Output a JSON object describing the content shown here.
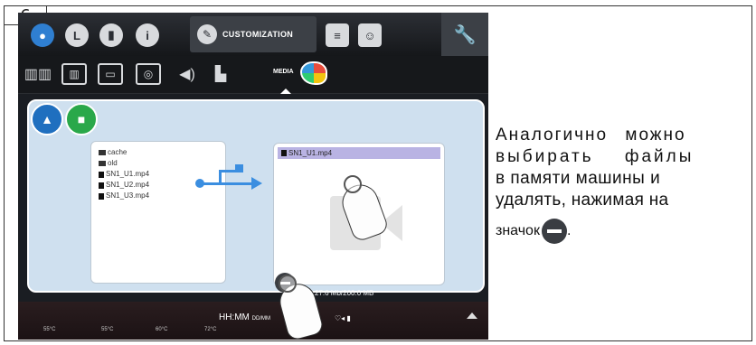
{
  "step": {
    "number": "6"
  },
  "topbar": {
    "customization_label": "CUSTOMIZATION"
  },
  "subbar": {
    "media_label": "MEDIA"
  },
  "media_panel": {
    "left_files": [
      "cache",
      "old",
      "SN1_U1.mp4",
      "SN1_U2.mp4",
      "SN1_U3.mp4"
    ],
    "selected_file": "SN1_U1.mp4",
    "storage_text": "27.6 Mb/200.0 MB"
  },
  "statusbar": {
    "clock": "HH:MM",
    "clock_suffix": "DD/MM",
    "temps": [
      "55°C",
      "55°C",
      "60°C",
      "72°C"
    ]
  },
  "description": {
    "line1": "Аналогично можно",
    "line2": "выбирать файлы",
    "line3": "в памяти машины и",
    "line4": "удалять, нажимая на",
    "line5": "значок",
    "line5_end": "."
  }
}
